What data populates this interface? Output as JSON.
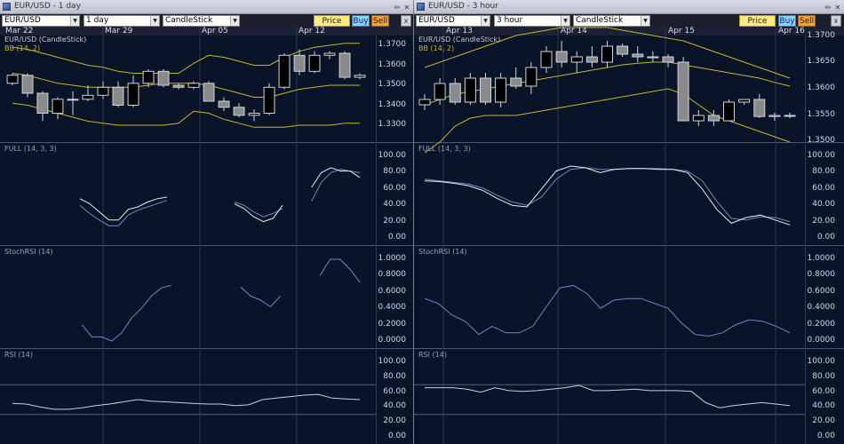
{
  "left": {
    "title": "EUR/USD - 1 day",
    "symbol": "EUR/USD",
    "interval": "1 day",
    "chart_style": "CandleStick",
    "price_box": "Price Box",
    "buy": "Buy",
    "sell": "Sell",
    "close": "x",
    "dates": [
      "Mar 22",
      "Mar 29",
      "Apr 05",
      "Apr 12"
    ],
    "panels": {
      "price": {
        "label": "EUR/USD (CandleStick)",
        "sub": "BB (14, 2)",
        "ticks": [
          "1.3700",
          "1.3600",
          "1.3500",
          "1.3400",
          "1.3300"
        ]
      },
      "full": {
        "label": "FULL (14, 3, 3)",
        "ticks": [
          "100.00",
          "80.00",
          "60.00",
          "40.00",
          "20.00",
          "0.00"
        ]
      },
      "stochrsi": {
        "label": "StochRSI (14)",
        "ticks": [
          "1.0000",
          "0.8000",
          "0.6000",
          "0.4000",
          "0.2000",
          "0.0000"
        ]
      },
      "rsi": {
        "label": "RSI (14)",
        "ticks": [
          "100.00",
          "80.00",
          "60.00",
          "40.00",
          "20.00",
          "0.00"
        ]
      }
    }
  },
  "right": {
    "title": "EUR/USD - 3 hour",
    "symbol": "EUR/USD",
    "interval": "3 hour",
    "chart_style": "CandleStick",
    "price_box": "Price Box",
    "buy": "Buy",
    "sell": "Sell",
    "close": "x",
    "dates": [
      "Apr 13",
      "Apr 14",
      "Apr 15",
      "Apr 16"
    ],
    "panels": {
      "price": {
        "label": "EUR/USD (CandleStick)",
        "sub": "BB (14, 2)",
        "ticks": [
          "1.3700",
          "1.3650",
          "1.3600",
          "1.3550",
          "1.3500"
        ]
      },
      "full": {
        "label": "FULL (14, 3, 3)",
        "ticks": [
          "100.00",
          "80.00",
          "60.00",
          "40.00",
          "20.00",
          "0.00"
        ]
      },
      "stochrsi": {
        "label": "StochRSI (14)",
        "ticks": [
          "1.0000",
          "0.8000",
          "0.6000",
          "0.4000",
          "0.2000",
          "0.0000"
        ]
      },
      "rsi": {
        "label": "RSI (14)",
        "ticks": [
          "100.00",
          "80.00",
          "60.00",
          "40.00",
          "20.00",
          "0.00"
        ]
      }
    }
  },
  "colors": {
    "background": "#0a1429",
    "grid": "#2e3b57",
    "bollinger": "#c8b52a",
    "k_line": "#e8ecf2",
    "d_line": "#6f86c8",
    "candle_up": "#000000",
    "candle_down": "#8a8a8a",
    "sell": "#f3a23a",
    "buy": "#8fd0ff",
    "price_box": "#ffe98a"
  },
  "chart_data": [
    {
      "type": "line",
      "title": "EUR/USD - 1 day",
      "candles": [
        {
          "o": 1.351,
          "h": 1.356,
          "l": 1.35,
          "c": 1.355
        },
        {
          "o": 1.355,
          "h": 1.356,
          "l": 1.344,
          "c": 1.346
        },
        {
          "o": 1.346,
          "h": 1.347,
          "l": 1.332,
          "c": 1.336
        },
        {
          "o": 1.336,
          "h": 1.344,
          "l": 1.333,
          "c": 1.343
        },
        {
          "o": 1.343,
          "h": 1.347,
          "l": 1.335,
          "c": 1.343
        },
        {
          "o": 1.343,
          "h": 1.35,
          "l": 1.342,
          "c": 1.345
        },
        {
          "o": 1.345,
          "h": 1.352,
          "l": 1.343,
          "c": 1.349
        },
        {
          "o": 1.349,
          "h": 1.352,
          "l": 1.339,
          "c": 1.34
        },
        {
          "o": 1.34,
          "h": 1.355,
          "l": 1.339,
          "c": 1.351
        },
        {
          "o": 1.351,
          "h": 1.358,
          "l": 1.349,
          "c": 1.357
        },
        {
          "o": 1.357,
          "h": 1.358,
          "l": 1.349,
          "c": 1.35
        },
        {
          "o": 1.35,
          "h": 1.351,
          "l": 1.348,
          "c": 1.349
        },
        {
          "o": 1.349,
          "h": 1.352,
          "l": 1.348,
          "c": 1.351
        },
        {
          "o": 1.351,
          "h": 1.352,
          "l": 1.342,
          "c": 1.342
        },
        {
          "o": 1.342,
          "h": 1.344,
          "l": 1.337,
          "c": 1.339
        },
        {
          "o": 1.339,
          "h": 1.341,
          "l": 1.334,
          "c": 1.335
        },
        {
          "o": 1.335,
          "h": 1.338,
          "l": 1.332,
          "c": 1.336
        },
        {
          "o": 1.336,
          "h": 1.351,
          "l": 1.335,
          "c": 1.349
        },
        {
          "o": 1.349,
          "h": 1.366,
          "l": 1.348,
          "c": 1.365
        },
        {
          "o": 1.365,
          "h": 1.368,
          "l": 1.355,
          "c": 1.357
        },
        {
          "o": 1.357,
          "h": 1.367,
          "l": 1.356,
          "c": 1.365
        },
        {
          "o": 1.365,
          "h": 1.367,
          "l": 1.363,
          "c": 1.366
        },
        {
          "o": 1.366,
          "h": 1.367,
          "l": 1.353,
          "c": 1.354
        },
        {
          "o": 1.354,
          "h": 1.356,
          "l": 1.353,
          "c": 1.355
        }
      ],
      "bb_upper": [
        1.369,
        1.368,
        1.366,
        1.364,
        1.362,
        1.36,
        1.359,
        1.357,
        1.356,
        1.356,
        1.356,
        1.356,
        1.361,
        1.365,
        1.364,
        1.362,
        1.36,
        1.36,
        1.364,
        1.367,
        1.369,
        1.37,
        1.371,
        1.371
      ],
      "bb_mid": [
        1.356,
        1.355,
        1.353,
        1.351,
        1.35,
        1.349,
        1.349,
        1.349,
        1.349,
        1.35,
        1.351,
        1.351,
        1.351,
        1.35,
        1.348,
        1.346,
        1.344,
        1.344,
        1.346,
        1.348,
        1.349,
        1.35,
        1.35,
        1.35
      ],
      "bb_lower": [
        1.341,
        1.34,
        1.338,
        1.336,
        1.334,
        1.332,
        1.331,
        1.33,
        1.33,
        1.33,
        1.33,
        1.331,
        1.337,
        1.336,
        1.333,
        1.331,
        1.329,
        1.329,
        1.329,
        1.33,
        1.33,
        1.33,
        1.331,
        1.331
      ],
      "full_k": [
        null,
        null,
        null,
        null,
        null,
        null,
        null,
        48,
        42,
        32,
        22,
        22,
        35,
        38,
        44,
        48,
        50,
        null,
        null,
        null,
        null,
        null,
        null,
        42,
        36,
        26,
        20,
        24,
        40,
        null,
        null,
        62,
        80,
        86,
        82,
        82,
        74
      ],
      "full_d": [
        null,
        null,
        null,
        null,
        null,
        null,
        null,
        40,
        30,
        22,
        15,
        15,
        28,
        34,
        38,
        42,
        46,
        null,
        null,
        null,
        null,
        null,
        null,
        44,
        40,
        32,
        26,
        30,
        36,
        null,
        null,
        45,
        68,
        80,
        84,
        82,
        80
      ],
      "stochrsi": [
        null,
        null,
        null,
        null,
        null,
        null,
        null,
        0.2,
        0.05,
        0.05,
        0.0,
        0.1,
        0.28,
        0.4,
        0.55,
        0.65,
        0.68,
        null,
        null,
        null,
        null,
        null,
        null,
        0.66,
        0.55,
        0.5,
        0.42,
        0.55,
        null,
        null,
        null,
        0.8,
        1.0,
        1.0,
        0.88,
        0.72
      ],
      "rsi": [
        45,
        44,
        40,
        37,
        37,
        39,
        42,
        44,
        47,
        50,
        48,
        47,
        46,
        45,
        44,
        44,
        42,
        43,
        50,
        52,
        54,
        56,
        57,
        52,
        51,
        50
      ]
    },
    {
      "type": "line",
      "title": "EUR/USD - 3 hour",
      "candles": [
        {
          "o": 1.357,
          "h": 1.359,
          "l": 1.356,
          "c": 1.358
        },
        {
          "o": 1.358,
          "h": 1.362,
          "l": 1.357,
          "c": 1.361
        },
        {
          "o": 1.361,
          "h": 1.362,
          "l": 1.357,
          "c": 1.3575
        },
        {
          "o": 1.3575,
          "h": 1.363,
          "l": 1.357,
          "c": 1.362
        },
        {
          "o": 1.362,
          "h": 1.363,
          "l": 1.357,
          "c": 1.3575
        },
        {
          "o": 1.3575,
          "h": 1.363,
          "l": 1.3565,
          "c": 1.362
        },
        {
          "o": 1.362,
          "h": 1.364,
          "l": 1.36,
          "c": 1.3605
        },
        {
          "o": 1.3605,
          "h": 1.365,
          "l": 1.359,
          "c": 1.364
        },
        {
          "o": 1.364,
          "h": 1.368,
          "l": 1.363,
          "c": 1.367
        },
        {
          "o": 1.367,
          "h": 1.369,
          "l": 1.364,
          "c": 1.365
        },
        {
          "o": 1.365,
          "h": 1.367,
          "l": 1.363,
          "c": 1.366
        },
        {
          "o": 1.366,
          "h": 1.368,
          "l": 1.364,
          "c": 1.365
        },
        {
          "o": 1.365,
          "h": 1.369,
          "l": 1.364,
          "c": 1.368
        },
        {
          "o": 1.368,
          "h": 1.3685,
          "l": 1.366,
          "c": 1.3665
        },
        {
          "o": 1.3665,
          "h": 1.368,
          "l": 1.365,
          "c": 1.366
        },
        {
          "o": 1.366,
          "h": 1.367,
          "l": 1.365,
          "c": 1.366
        },
        {
          "o": 1.366,
          "h": 1.3665,
          "l": 1.364,
          "c": 1.365
        },
        {
          "o": 1.365,
          "h": 1.366,
          "l": 1.354,
          "c": 1.354
        },
        {
          "o": 1.354,
          "h": 1.356,
          "l": 1.353,
          "c": 1.355
        },
        {
          "o": 1.355,
          "h": 1.356,
          "l": 1.353,
          "c": 1.354
        },
        {
          "o": 1.354,
          "h": 1.358,
          "l": 1.354,
          "c": 1.3575
        },
        {
          "o": 1.3575,
          "h": 1.358,
          "l": 1.357,
          "c": 1.358
        },
        {
          "o": 1.358,
          "h": 1.359,
          "l": 1.3545,
          "c": 1.3548
        },
        {
          "o": 1.3548,
          "h": 1.3555,
          "l": 1.354,
          "c": 1.355
        },
        {
          "o": 1.355,
          "h": 1.3555,
          "l": 1.3545,
          "c": 1.355
        }
      ],
      "bb_upper": [
        1.364,
        1.365,
        1.366,
        1.367,
        1.368,
        1.369,
        1.37,
        1.3705,
        1.371,
        1.3715,
        1.3715,
        1.3715,
        1.3715,
        1.371,
        1.3705,
        1.37,
        1.3695,
        1.369,
        1.368,
        1.367,
        1.366,
        1.365,
        1.364,
        1.363,
        1.362
      ],
      "bb_mid": [
        1.357,
        1.358,
        1.359,
        1.3595,
        1.36,
        1.3605,
        1.361,
        1.3615,
        1.362,
        1.3625,
        1.363,
        1.3635,
        1.364,
        1.3645,
        1.3648,
        1.365,
        1.365,
        1.3645,
        1.364,
        1.3635,
        1.363,
        1.3625,
        1.362,
        1.3612,
        1.3605
      ],
      "bb_lower": [
        1.348,
        1.35,
        1.353,
        1.3545,
        1.355,
        1.355,
        1.355,
        1.3555,
        1.356,
        1.3565,
        1.357,
        1.3575,
        1.358,
        1.3585,
        1.359,
        1.3595,
        1.36,
        1.359,
        1.357,
        1.355,
        1.354,
        1.353,
        1.352,
        1.351,
        1.35
      ],
      "full_k": [
        70,
        69,
        67,
        64,
        58,
        48,
        40,
        38,
        60,
        82,
        88,
        86,
        80,
        84,
        85,
        85,
        84,
        84,
        80,
        60,
        35,
        18,
        25,
        28,
        22,
        16
      ],
      "full_d": [
        72,
        70,
        68,
        66,
        61,
        52,
        44,
        40,
        50,
        72,
        84,
        86,
        84,
        84,
        85,
        85,
        85,
        84,
        82,
        70,
        45,
        24,
        22,
        26,
        25,
        20
      ],
      "stochrsi": [
        0.52,
        0.46,
        0.32,
        0.24,
        0.08,
        0.18,
        0.1,
        0.1,
        0.18,
        0.42,
        0.65,
        0.68,
        0.58,
        0.4,
        0.5,
        0.52,
        0.52,
        0.46,
        0.4,
        0.22,
        0.08,
        0.06,
        0.1,
        0.2,
        0.26,
        0.24,
        0.18,
        0.1
      ],
      "rsi": [
        66,
        66,
        66,
        64,
        60,
        66,
        62,
        61,
        62,
        64,
        66,
        69,
        62,
        62,
        63,
        64,
        62,
        62,
        62,
        61,
        46,
        39,
        42,
        44,
        46,
        44,
        42
      ]
    }
  ]
}
